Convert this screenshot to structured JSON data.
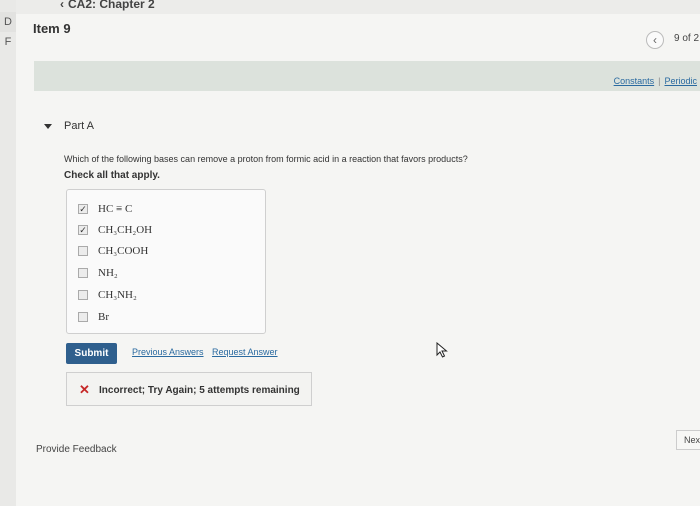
{
  "header": {
    "left_fragment": "D F",
    "breadcrumb": "CA2: Chapter 2",
    "item_title": "Item 9",
    "nav_count": "9 of 2"
  },
  "toolbar": {
    "constants_label": "Constants",
    "separator": "|",
    "periodic_label": "Periodic"
  },
  "part": {
    "label": "Part A",
    "question": "Which of the following bases can remove a proton from formic acid in a reaction that favors products?",
    "instruction": "Check all that apply."
  },
  "options": [
    {
      "label": "HC ≡ C",
      "checked": true
    },
    {
      "label": "CH₃CH₂OH",
      "checked": true
    },
    {
      "label": "CH₃COOH",
      "checked": false
    },
    {
      "label": "NH₂",
      "checked": false
    },
    {
      "label": "CH₃NH₂",
      "checked": false
    },
    {
      "label": "Br",
      "checked": false
    }
  ],
  "actions": {
    "submit_label": "Submit",
    "previous_answers_label": "Previous Answers",
    "request_answer_label": "Request Answer"
  },
  "feedback": {
    "icon": "x-icon",
    "message": "Incorrect; Try Again; 5 attempts remaining"
  },
  "footer": {
    "provide_feedback_label": "Provide Feedback",
    "next_label": "Next"
  },
  "colors": {
    "accent": "#2f5f8d",
    "link": "#2a6aa0",
    "error": "#c62828",
    "toolbar_bg": "#dce2dc"
  }
}
